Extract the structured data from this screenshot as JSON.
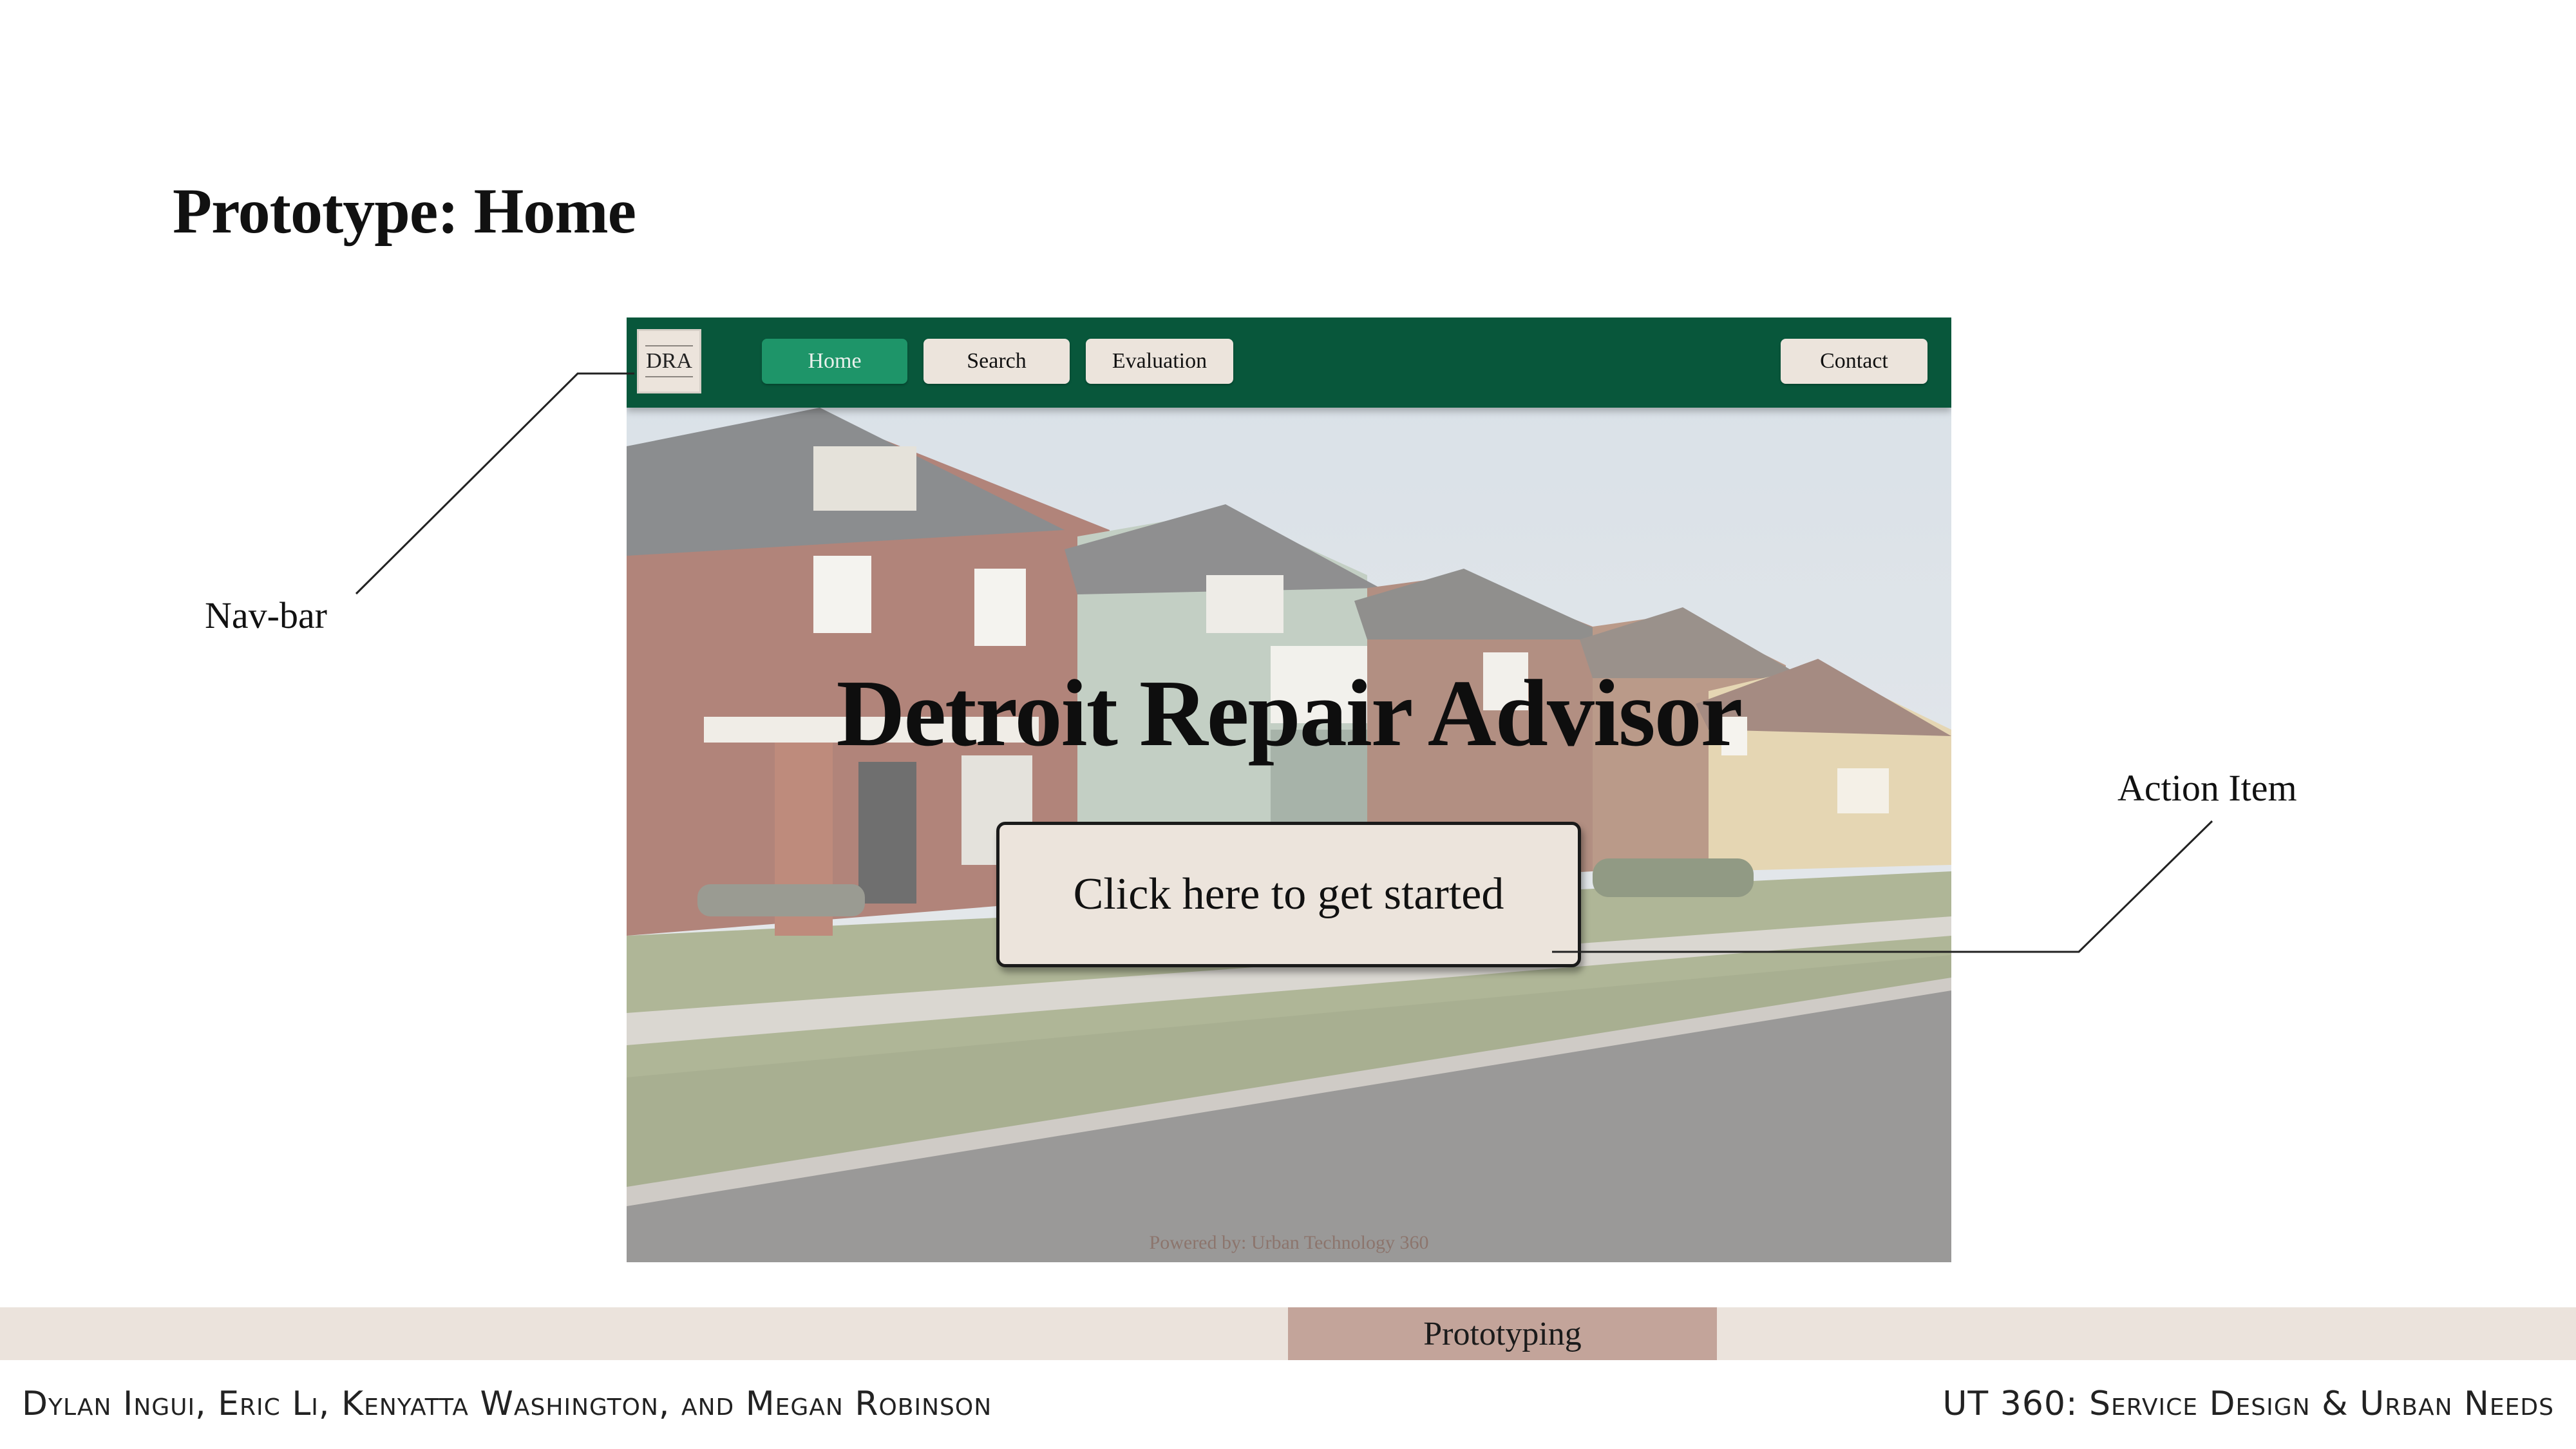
{
  "slide": {
    "title": "Prototype: Home",
    "annotations": {
      "navbar": "Nav-bar",
      "action": "Action Item"
    },
    "section_tab": "Prototyping",
    "footer_left": "Dylan Ingui, Eric Li, Kenyatta Washington, and Megan Robinson",
    "footer_right": "UT 360: Service Design & Urban Needs"
  },
  "prototype": {
    "logo": "DRA",
    "nav": {
      "home": "Home",
      "search": "Search",
      "evaluation": "Evaluation",
      "contact": "Contact"
    },
    "hero_title": "Detroit Repair Advisor",
    "cta_label": "Click here to get started",
    "powered_by": "Powered by: Urban Technology 360"
  },
  "colors": {
    "navbar": "#08573b",
    "nav_active": "#1e9569",
    "button_bg": "#ece4dc",
    "footer_band": "#ebe3dc",
    "section_tab": "#c3a49a"
  }
}
